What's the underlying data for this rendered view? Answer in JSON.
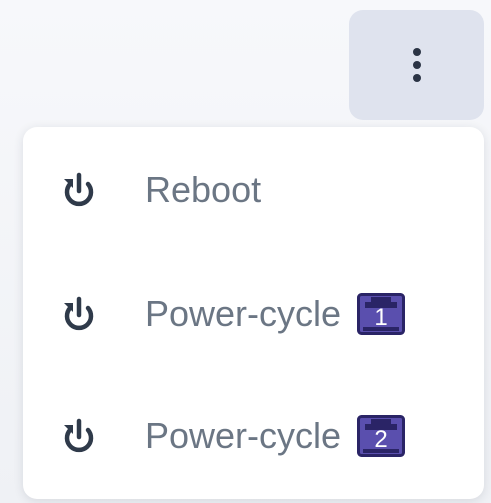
{
  "header": {
    "menu_button": {
      "icon": "more-vertical-icon"
    }
  },
  "menu": {
    "items": [
      {
        "label": "Reboot",
        "icon": "power-icon"
      },
      {
        "label": "Power-cycle",
        "icon": "power-icon",
        "badge": {
          "icon": "ethernet-port-icon",
          "number": "1"
        }
      },
      {
        "label": "Power-cycle",
        "icon": "power-icon",
        "badge": {
          "icon": "ethernet-port-icon",
          "number": "2"
        }
      }
    ]
  },
  "colors": {
    "icon": "#2f3a4a",
    "label": "#6b7684",
    "badge_fill": "#5a4fae",
    "badge_dark": "#2a2466",
    "button_bg": "#dfe3ee"
  }
}
